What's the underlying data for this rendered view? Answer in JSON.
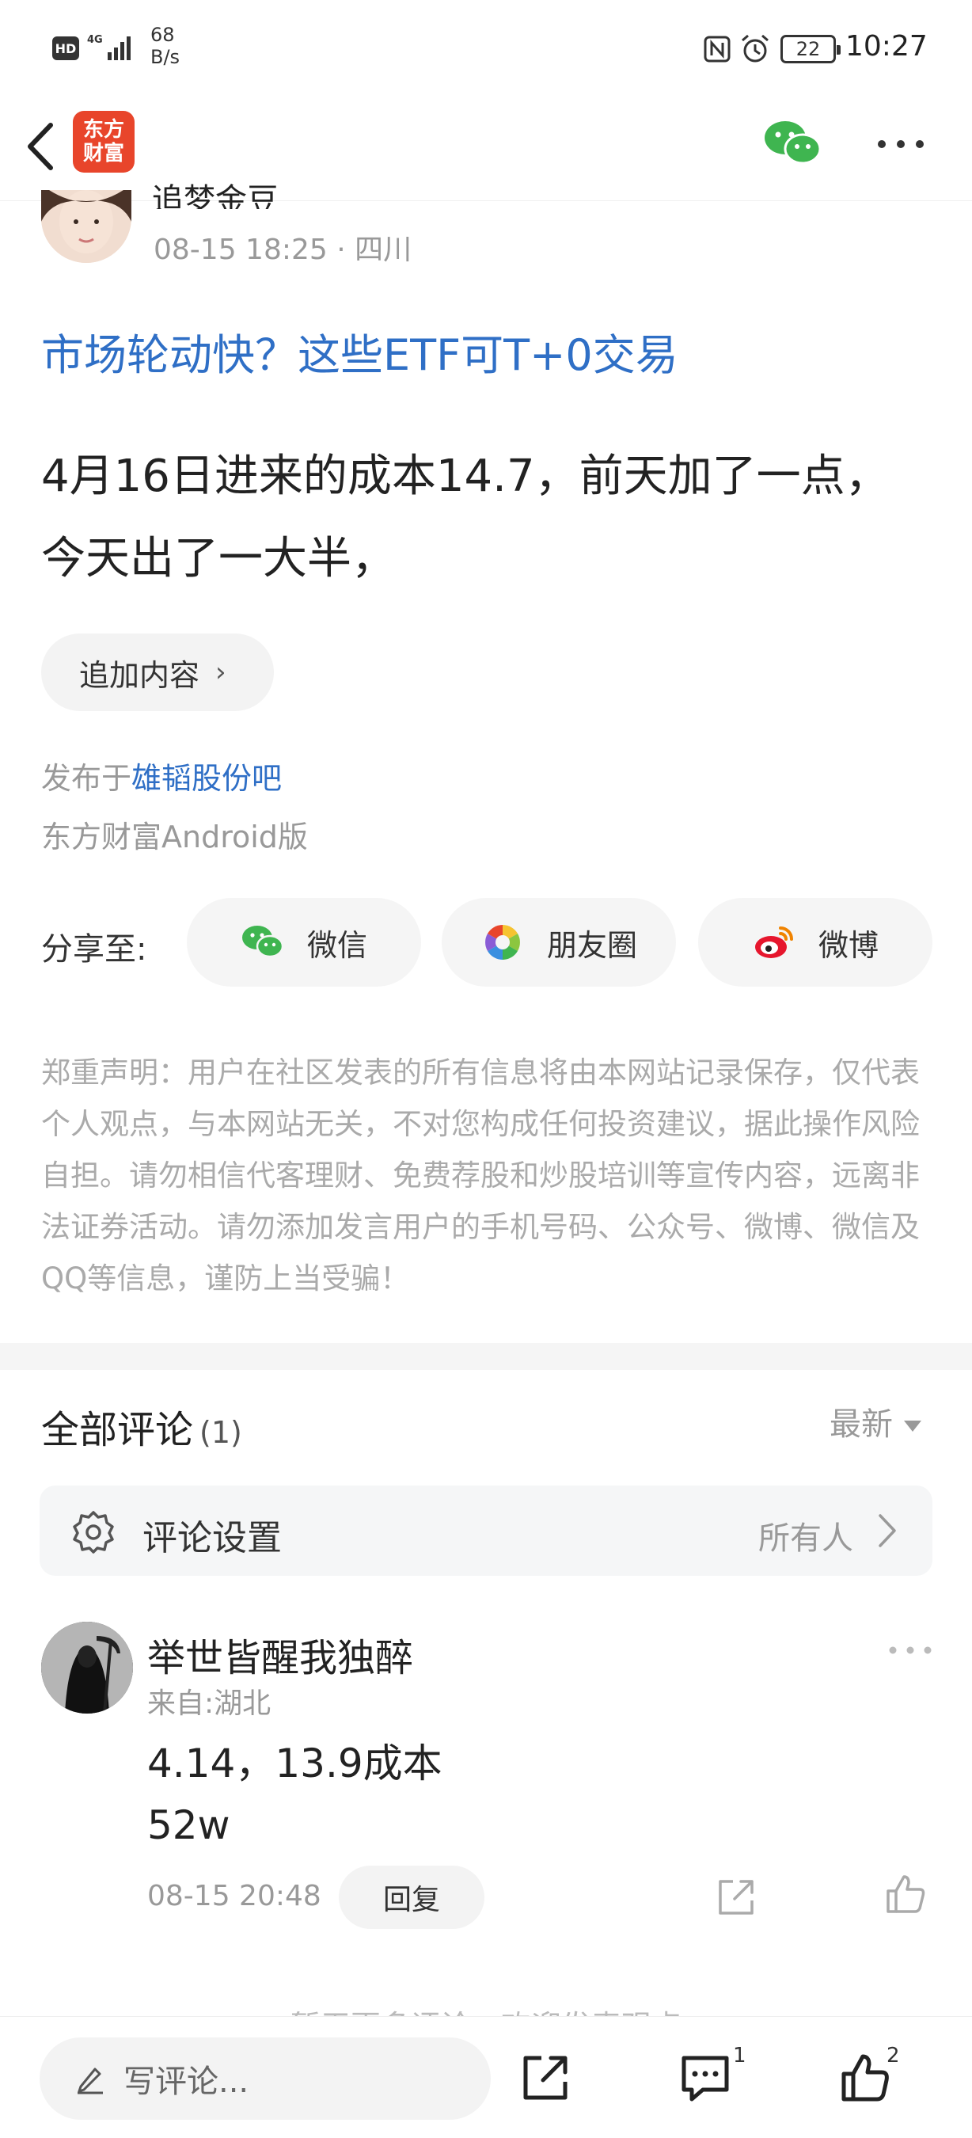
{
  "status_bar": {
    "network": "HD",
    "signal": "4G",
    "rate_value": "68",
    "rate_unit": "B/s",
    "battery": "22",
    "time": "10:27"
  },
  "header": {
    "logo_line1": "东方",
    "logo_line2": "财富"
  },
  "post": {
    "author_name": "追梦金豆",
    "meta": "08-15 18:25 · 四川",
    "topic_link": "市场轮动快？这些ETF可T+0交易",
    "body_line1": "4月16日进来的成本14.7，前天加了一点，",
    "body_line2": "今天出了一大半，",
    "append_label": "追加内容",
    "published_prefix": "发布于",
    "published_bar": "雄韬股份吧",
    "client": "东方财富Android版"
  },
  "share": {
    "label": "分享至:",
    "options": [
      {
        "label": "微信",
        "icon": "wechat-icon",
        "color": "#3fb550"
      },
      {
        "label": "朋友圈",
        "icon": "moments-icon",
        "color": "#e9a628"
      },
      {
        "label": "微博",
        "icon": "weibo-icon",
        "color": "#e6162d"
      }
    ]
  },
  "disclaimer": "郑重声明：用户在社区发表的所有信息将由本网站记录保存，仅代表个人观点，与本网站无关，不对您构成任何投资建议，据此操作风险自担。请勿相信代客理财、免费荐股和炒股培训等宣传内容，远离非法证券活动。请勿添加发言用户的手机号码、公众号、微博、微信及QQ等信息，谨防上当受骗！",
  "comments": {
    "title": "全部评论",
    "count": "(1)",
    "sort_label": "最新",
    "settings_label": "评论设置",
    "settings_value": "所有人",
    "items": [
      {
        "name": "举世皆醒我独醉",
        "from": "来自:湖北",
        "line1": "4.14，13.9成本",
        "line2": "52w",
        "time": "08-15 20:48",
        "reply_label": "回复"
      }
    ],
    "no_more": "暂无更多评论，欢迎发表观点"
  },
  "bottom_bar": {
    "placeholder": "写评论...",
    "comment_count": "1",
    "like_count": "2"
  },
  "colors": {
    "link": "#2f6fc6",
    "brand": "#e8452b",
    "muted": "#999999"
  }
}
